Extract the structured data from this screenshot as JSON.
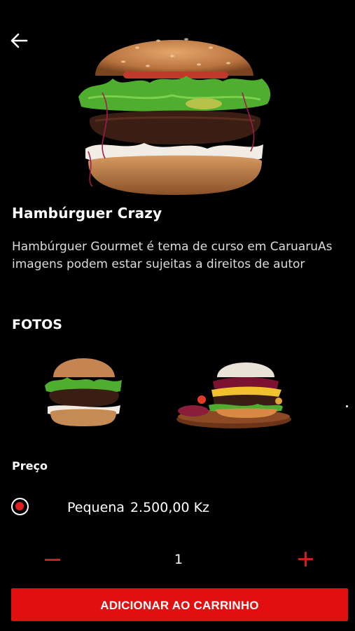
{
  "header": {
    "back_icon": "arrow-left-icon"
  },
  "product": {
    "name": "Hambúrguer Crazy",
    "description": "Hambúrguer Gourmet é tema de curso em CaruaruAs imagens podem estar sujeitas a direitos de autor"
  },
  "photos": {
    "heading": "FOTOS"
  },
  "price": {
    "heading": "Preço",
    "options": [
      {
        "size": "Pequena",
        "price": "2.500,00 Kz",
        "selected": true
      }
    ]
  },
  "quantity": {
    "value": "1",
    "minus_icon": "minus-icon",
    "plus_icon": "plus-icon"
  },
  "cart": {
    "add_label": "ADICIONAR AO CARRINHO"
  },
  "colors": {
    "accent": "#e10f0f",
    "background": "#000000",
    "text": "#ffffff"
  }
}
